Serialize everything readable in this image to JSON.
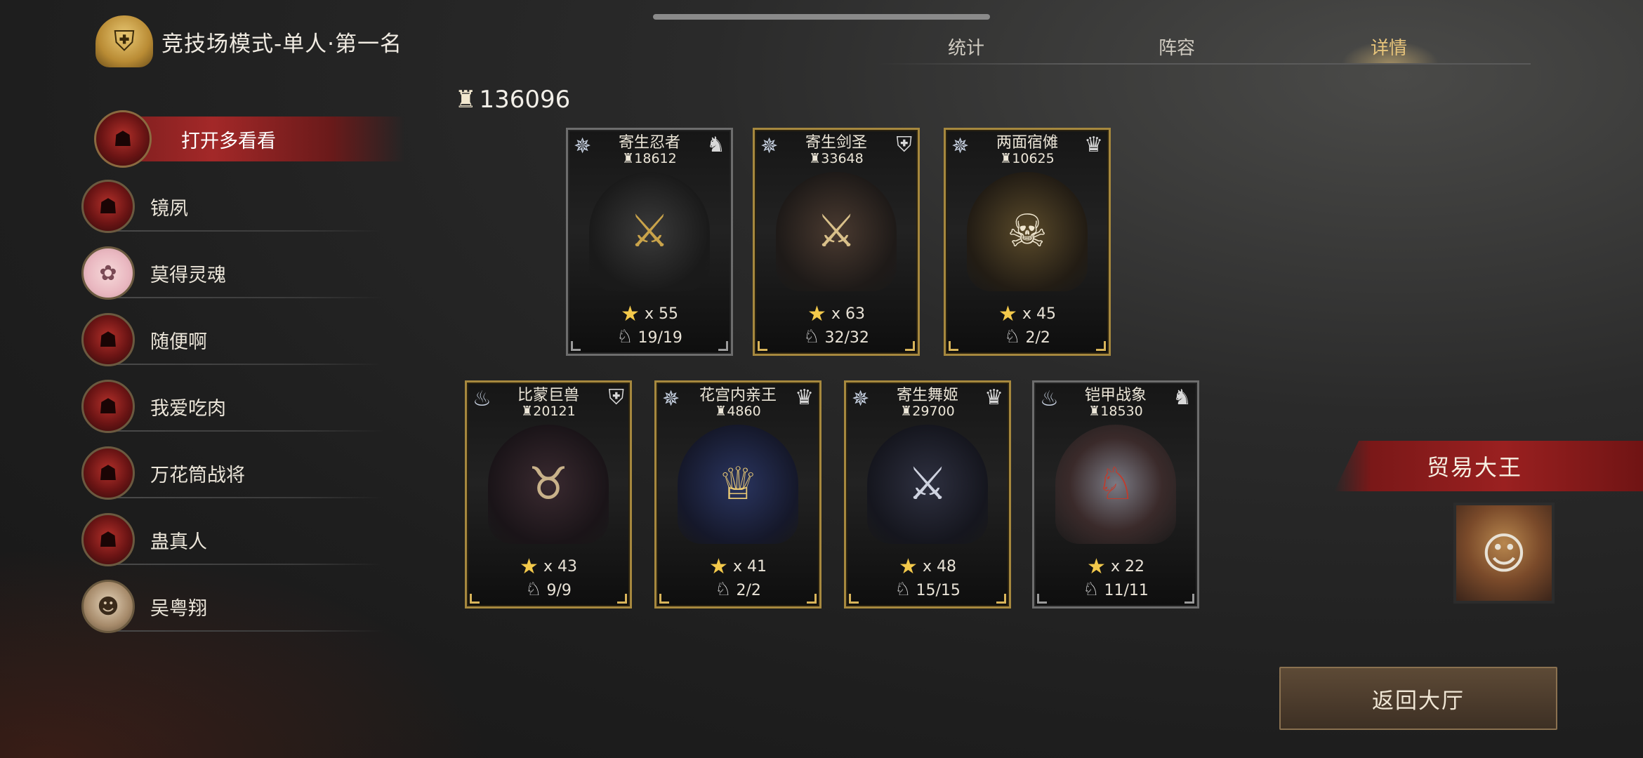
{
  "header": {
    "title": "竞技场模式-单人·第一名",
    "tabs": [
      {
        "label": "统计",
        "active": false
      },
      {
        "label": "阵容",
        "active": false
      },
      {
        "label": "详情",
        "active": true
      }
    ]
  },
  "players": [
    {
      "name": "打开多看看",
      "avatar": "demon-mask",
      "selected": true
    },
    {
      "name": "镜夙",
      "avatar": "demon-mask",
      "selected": false
    },
    {
      "name": "莫得灵魂",
      "avatar": "pink-cake",
      "selected": false
    },
    {
      "name": "随便啊",
      "avatar": "demon-mask",
      "selected": false
    },
    {
      "name": "我爱吃肉",
      "avatar": "demon-mask",
      "selected": false
    },
    {
      "name": "万花筒战将",
      "avatar": "demon-mask",
      "selected": false
    },
    {
      "name": "蛊真人",
      "avatar": "demon-mask",
      "selected": false
    },
    {
      "name": "吴粤翔",
      "avatar": "ogre-face",
      "selected": false
    }
  ],
  "total_power": "136096",
  "units_row1": [
    {
      "name": "寄生忍者",
      "power": "18612",
      "stars": "x 55",
      "count": "19/19",
      "type_icon": "star-compass-icon",
      "class_icon": "horse-head-icon",
      "frame": "silver"
    },
    {
      "name": "寄生剑圣",
      "power": "33648",
      "stars": "x 63",
      "count": "32/32",
      "type_icon": "star-compass-icon",
      "class_icon": "shield-icon",
      "frame": "gold"
    },
    {
      "name": "两面宿傩",
      "power": "10625",
      "stars": "x 45",
      "count": "2/2",
      "type_icon": "star-compass-icon",
      "class_icon": "crown-icon",
      "frame": "gold"
    }
  ],
  "units_row2": [
    {
      "name": "比蒙巨兽",
      "power": "20121",
      "stars": "x 43",
      "count": "9/9",
      "type_icon": "flame-icon",
      "class_icon": "shield-icon",
      "frame": "gold"
    },
    {
      "name": "花宫内亲王",
      "power": "4860",
      "stars": "x 41",
      "count": "2/2",
      "type_icon": "star-compass-icon",
      "class_icon": "crown-icon",
      "frame": "gold"
    },
    {
      "name": "寄生舞姬",
      "power": "29700",
      "stars": "x 48",
      "count": "15/15",
      "type_icon": "star-compass-icon",
      "class_icon": "crown-icon",
      "frame": "gold"
    },
    {
      "name": "铠甲战象",
      "power": "18530",
      "stars": "x 22",
      "count": "11/11",
      "type_icon": "flame-icon",
      "class_icon": "horse-head-icon",
      "frame": "silver"
    }
  ],
  "winner": {
    "label": "贸易大王"
  },
  "buttons": {
    "back": "返回大厅"
  },
  "colors": {
    "accent_gold": "#e7c47a",
    "banner_red": "#9a2020",
    "frame_gold": "#a6883e"
  }
}
